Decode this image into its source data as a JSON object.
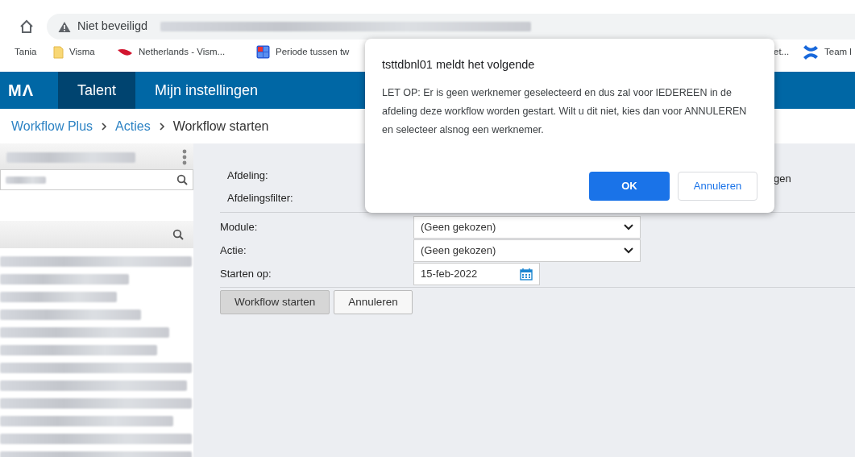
{
  "browser": {
    "security_label": "Niet beveiligd",
    "bookmarks": [
      {
        "label": "Tania",
        "kind": "plain"
      },
      {
        "label": "Visma",
        "kind": "folder"
      },
      {
        "label": "Netherlands - Vism...",
        "kind": "swoosh"
      },
      {
        "label": "Periode tussen tw",
        "kind": "grid"
      }
    ],
    "bookmarks_right": [
      {
        "label": "et...",
        "kind": "plain"
      },
      {
        "label": "Team l",
        "kind": "confluence"
      }
    ]
  },
  "navbar": {
    "logo": "MΛ",
    "tabs": [
      {
        "label": "Talent",
        "selected": true
      },
      {
        "label": "Mijn instellingen",
        "selected": false
      }
    ]
  },
  "breadcrumb": [
    {
      "label": "Workflow Plus",
      "kind": "link"
    },
    {
      "label": "Acties",
      "kind": "link"
    },
    {
      "label": "Workflow starten",
      "kind": "current"
    }
  ],
  "form": {
    "top_labels": [
      "Afdeling:",
      "Afdelingsfilter:"
    ],
    "right_text": "gen",
    "fields": [
      {
        "label": "Module:",
        "kind": "select",
        "value": "(Geen gekozen)"
      },
      {
        "label": "Actie:",
        "kind": "select",
        "value": "(Geen gekozen)"
      },
      {
        "label": "Starten op:",
        "kind": "date",
        "value": "15-feb-2022"
      }
    ],
    "buttons": [
      {
        "label": "Workflow starten",
        "selected": true
      },
      {
        "label": "Annuleren",
        "selected": false
      }
    ]
  },
  "dialog": {
    "title": "tsttdbnl01 meldt het volgende",
    "message": "LET OP: Er is geen werknemer geselecteerd en dus zal voor IEDEREEN in de afdeling deze workflow worden gestart. Wilt u dit niet, kies dan voor ANNULEREN en selecteer alsnog een werknemer.",
    "ok": "OK",
    "cancel": "Annuleren"
  }
}
